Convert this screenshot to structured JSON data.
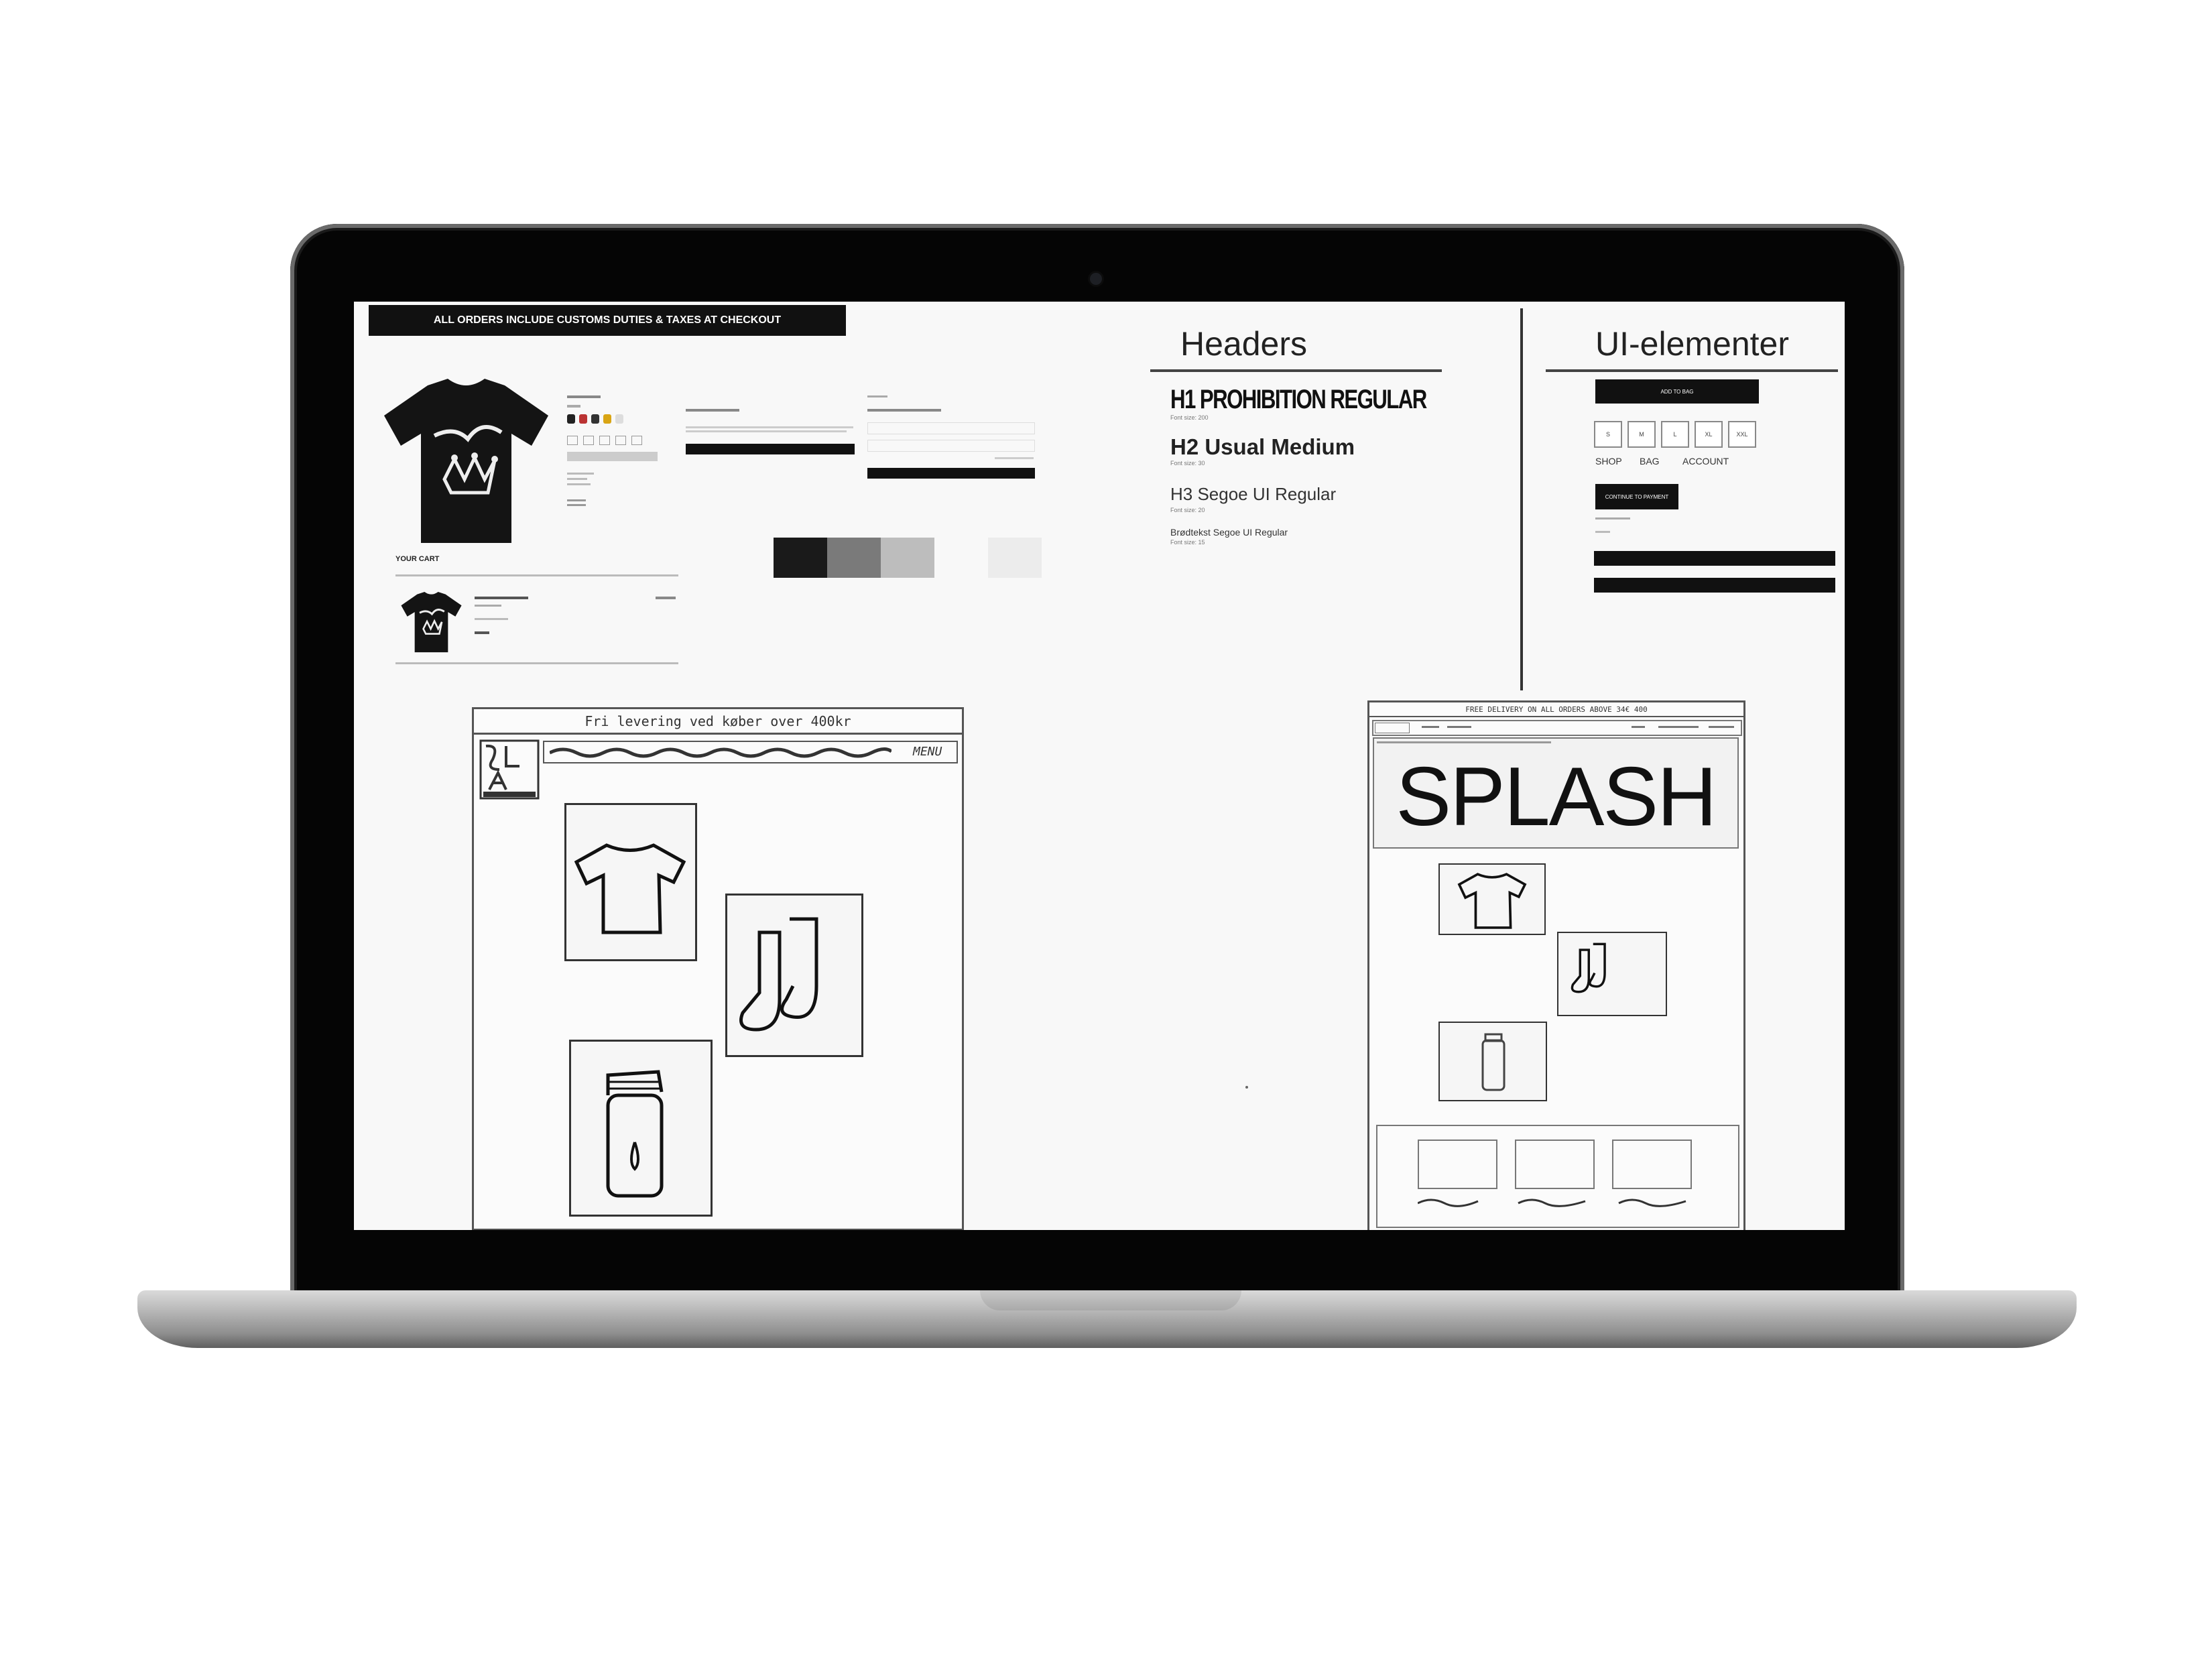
{
  "banner": {
    "text": "ALL ORDERS INCLUDE CUSTOMS DUTIES & TAXES AT CHECKOUT"
  },
  "cart": {
    "title": "YOUR CART"
  },
  "headers_section": {
    "title": "Headers",
    "h1": {
      "text": "H1 PROHIBITION REGULAR",
      "note": "Font size: 200"
    },
    "h2": {
      "text": "H2 Usual Medium",
      "note": "Font size: 30"
    },
    "h3": {
      "text": "H3 Segoe UI Regular",
      "note": "Font size: 20"
    },
    "body": {
      "text": "Brødtekst Segoe UI Regular",
      "note": "Font size: 15"
    }
  },
  "ui_section": {
    "title": "UI-elementer",
    "add_to_bag": "ADD TO BAG",
    "sizes": [
      "S",
      "M",
      "L",
      "XL",
      "XXL"
    ],
    "nav": [
      "SHOP",
      "BAG",
      "ACCOUNT"
    ],
    "continue": "CONTINUE TO PAYMENT"
  },
  "palette": {
    "colors": [
      "#1a1a1a",
      "#7a7a7a",
      "#bdbdbd",
      "#ececec"
    ]
  },
  "sketch_left": {
    "banner": "Fri levering ved køber over 400kr",
    "menu": "MENU"
  },
  "sketch_right": {
    "banner": "FREE DELIVERY ON ALL ORDERS ABOVE 34€ 400",
    "splash": "SPLASH"
  }
}
